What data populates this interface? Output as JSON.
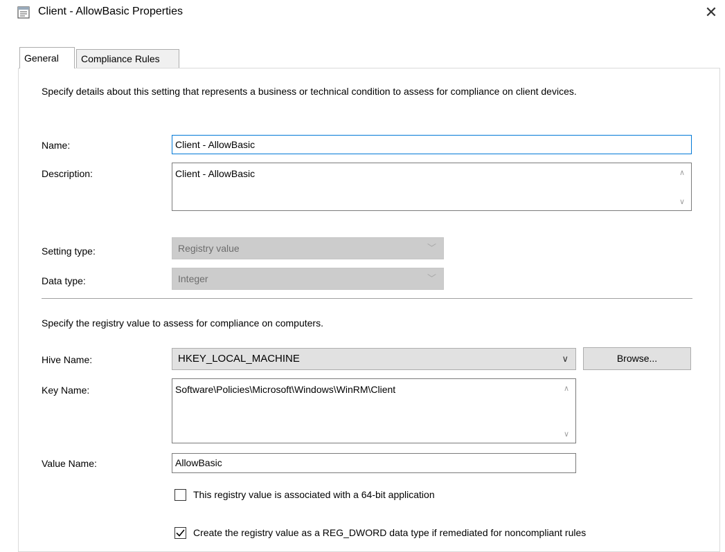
{
  "window": {
    "title": "Client - AllowBasic Properties",
    "close_glyph": "✕"
  },
  "tabs": [
    {
      "label": "General",
      "active": true
    },
    {
      "label": "Compliance Rules",
      "active": false
    }
  ],
  "general": {
    "intro": "Specify details about this setting that represents a business or technical condition to assess for compliance on client devices.",
    "name_label": "Name:",
    "name_value": "Client - AllowBasic",
    "description_label": "Description:",
    "description_value": "Client - AllowBasic",
    "setting_type_label": "Setting type:",
    "setting_type_value": "Registry value",
    "data_type_label": "Data type:",
    "data_type_value": "Integer",
    "registry_intro": "Specify the registry value to assess for compliance on computers.",
    "hive_label": "Hive Name:",
    "hive_value": "HKEY_LOCAL_MACHINE",
    "browse_label": "Browse...",
    "key_label": "Key Name:",
    "key_value": "Software\\Policies\\Microsoft\\Windows\\WinRM\\Client",
    "value_name_label": "Value Name:",
    "value_name_value": "AllowBasic",
    "checkbox_64bit_label": "This registry value is associated with a 64-bit application",
    "checkbox_64bit_checked": false,
    "checkbox_dword_label": "Create the registry value as a REG_DWORD data type if remediated for noncompliant rules",
    "checkbox_dword_checked": true
  }
}
